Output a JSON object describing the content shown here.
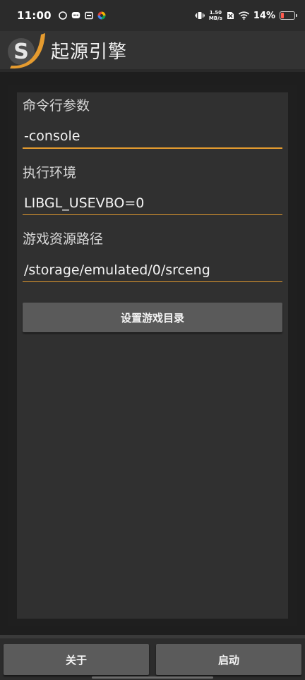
{
  "status_bar": {
    "time": "11:00",
    "net_speed_value": "1.50",
    "net_speed_unit": "MB/s",
    "battery_percent": "14%",
    "left_icons": [
      "swirl-icon",
      "chat-icon",
      "tray-icon",
      "colorwheel-icon"
    ],
    "right_icons": [
      "vibrate-icon",
      "no-sim-icon",
      "wifi-icon",
      "battery-icon"
    ]
  },
  "app_bar": {
    "title": "起源引擎",
    "logo_letter": "S",
    "accent_color": "#e59b2f"
  },
  "form": {
    "cmd_label": "命令行参数",
    "cmd_value": "-console",
    "env_label": "执行环境",
    "env_value": "LIBGL_USEVBO=0",
    "path_label": "游戏资源路径",
    "path_value": "/storage/emulated/0/srceng",
    "set_dir_button": "设置游戏目录"
  },
  "bottom": {
    "about_button": "关于",
    "launch_button": "启动"
  }
}
